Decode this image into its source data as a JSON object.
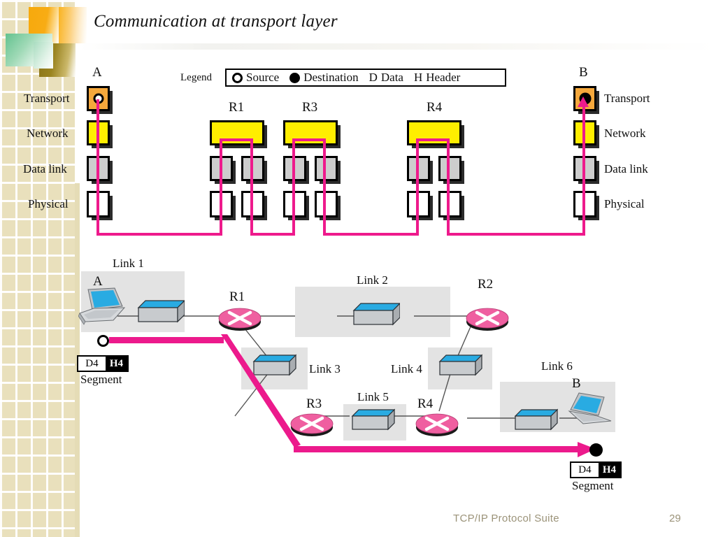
{
  "slide": {
    "title": "Communication at transport layer",
    "footer_title": "TCP/IP Protocol Suite",
    "page_number": "29"
  },
  "legend": {
    "word": "Legend",
    "items": [
      {
        "icon": "open-circle-icon",
        "label": "Source"
      },
      {
        "icon": "filled-circle-icon",
        "label": "Destination"
      },
      {
        "icon": "letter-d",
        "label": "D  Data"
      },
      {
        "icon": "letter-h",
        "label": "H  Header"
      }
    ],
    "source_label": "Source",
    "destination_label": "Destination",
    "data_label": "Data",
    "data_letter": "D",
    "header_label": "Header",
    "header_letter": "H"
  },
  "stack_diagram": {
    "layer_labels": [
      "Transport",
      "Network",
      "Data link",
      "Physical"
    ],
    "host_a_label": "A",
    "host_b_label": "B",
    "router_labels": [
      "R1",
      "R3",
      "R4"
    ],
    "left_labels": [
      "Transport",
      "Network",
      "Data link",
      "Physical"
    ],
    "right_labels": [
      "Transport",
      "Network",
      "Data link",
      "Physical"
    ],
    "colors": {
      "transport": "#f5a83c",
      "network": "#ffee00",
      "datalink": "#cdcdcd",
      "physical": "#ffffff",
      "path": "#ee1a8c"
    }
  },
  "network_diagram": {
    "links": [
      "Link 1",
      "Link 2",
      "Link 3",
      "Link 4",
      "Link 5",
      "Link 6"
    ],
    "routers": [
      "R1",
      "R2",
      "R3",
      "R4"
    ],
    "host_a_label": "A",
    "host_b_label": "B",
    "source_segment": {
      "data": "D4",
      "header": "H4",
      "caption": "Segment"
    },
    "destination_segment": {
      "data": "D4",
      "header": "H4",
      "caption": "Segment"
    },
    "colors": {
      "router": "#ef5fa0",
      "switch_top": "#29abe2",
      "path": "#ec1a8c",
      "link_bg": "#e3e3e3"
    }
  }
}
